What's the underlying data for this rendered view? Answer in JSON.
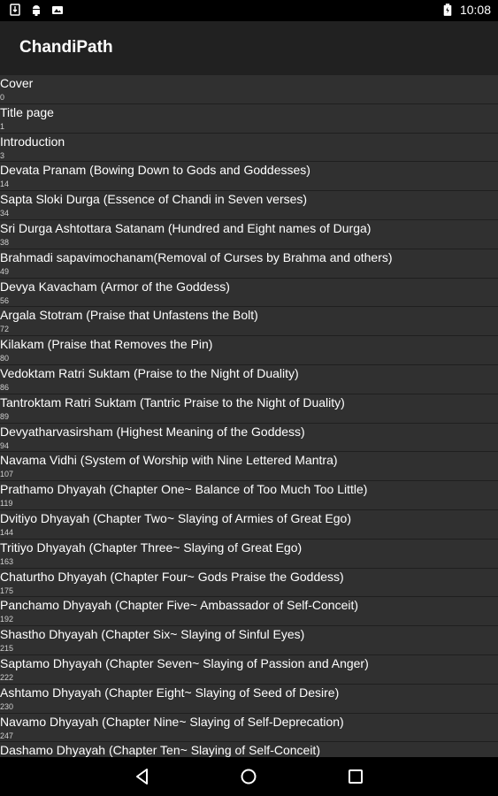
{
  "status_bar": {
    "time": "10:08",
    "icons": [
      "sim-download-icon",
      "android-icon",
      "photo-icon",
      "battery-icon"
    ]
  },
  "app_bar": {
    "title": "ChandiPath"
  },
  "toc": [
    {
      "title": "Cover",
      "page": "0"
    },
    {
      "title": "Title page",
      "page": "1"
    },
    {
      "title": "Introduction",
      "page": "3"
    },
    {
      "title": "Devata Pranam (Bowing Down to Gods and Goddesses)",
      "page": "14"
    },
    {
      "title": "Sapta Sloki Durga (Essence of Chandi in Seven verses)",
      "page": "34"
    },
    {
      "title": "Sri Durga Ashtottara Satanam (Hundred and Eight names of Durga)",
      "page": "38"
    },
    {
      "title": "Brahmadi sapavimochanam(Removal of Curses by Brahma and others)",
      "page": "49"
    },
    {
      "title": "Devya Kavacham (Armor of the Goddess)",
      "page": "56"
    },
    {
      "title": "Argala Stotram (Praise that Unfastens the Bolt)",
      "page": "72"
    },
    {
      "title": "Kilakam (Praise that Removes the Pin)",
      "page": "80"
    },
    {
      "title": "Vedoktam Ratri Suktam (Praise to the Night of Duality)",
      "page": "86"
    },
    {
      "title": "Tantroktam Ratri Suktam (Tantric Praise to the Night of Duality)",
      "page": "89"
    },
    {
      "title": "Devyatharvasirsham (Highest Meaning of the Goddess)",
      "page": "94"
    },
    {
      "title": "Navama Vidhi (System of Worship with Nine Lettered Mantra)",
      "page": "107"
    },
    {
      "title": "Prathamo Dhyayah (Chapter One~ Balance of Too Much Too Little)",
      "page": "119"
    },
    {
      "title": "Dvitiyo Dhyayah (Chapter Two~ Slaying of Armies of Great Ego)",
      "page": "144"
    },
    {
      "title": "Tritiyo Dhyayah (Chapter Three~ Slaying of Great Ego)",
      "page": "163"
    },
    {
      "title": "Chaturtho Dhyayah (Chapter Four~ Gods Praise the Goddess)",
      "page": "175"
    },
    {
      "title": "Panchamo Dhyayah (Chapter Five~ Ambassador of Self-Conceit)",
      "page": "192"
    },
    {
      "title": "Shastho Dhyayah (Chapter Six~ Slaying of Sinful Eyes)",
      "page": "215"
    },
    {
      "title": "Saptamo Dhyayah (Chapter Seven~ Slaying of Passion and Anger)",
      "page": "222"
    },
    {
      "title": "Ashtamo Dhyayah (Chapter Eight~ Slaying of Seed of Desire)",
      "page": "230"
    },
    {
      "title": "Navamo Dhyayah (Chapter Nine~ Slaying of Self-Deprecation)",
      "page": "247"
    },
    {
      "title": "Dashamo Dhyayah (Chapter Ten~ Slaying of Self-Conceit)",
      "page": ""
    }
  ],
  "nav_bar": {
    "buttons": [
      "back-icon",
      "home-icon",
      "recents-icon"
    ]
  },
  "colors": {
    "list_bg": "#303030",
    "app_bar_bg": "#212121",
    "bars_bg": "#000000",
    "text": "#ffffff"
  }
}
